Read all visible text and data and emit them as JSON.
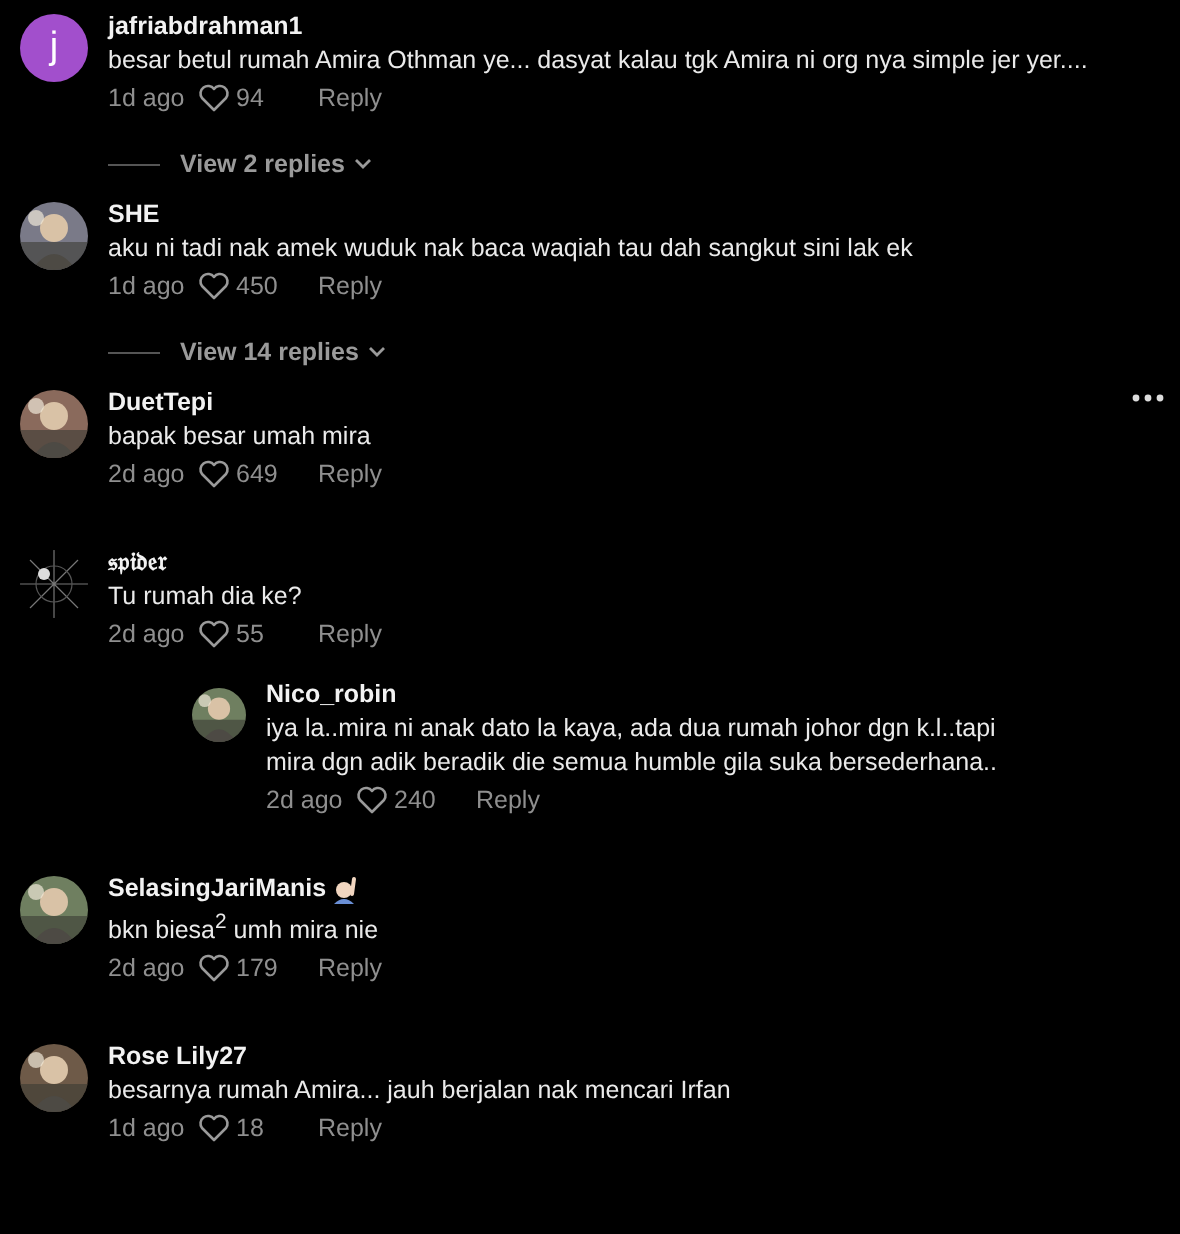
{
  "comments": [
    {
      "avatar": {
        "kind": "letter",
        "letter": "j",
        "color": "#a24fcc"
      },
      "username": "jafriabdrahman1",
      "text": "besar betul rumah Amira Othman ye... dasyat kalau tgk Amira ni org nya simple jer yer....",
      "time": "1d ago",
      "likes": "94",
      "reply": "Reply",
      "view_replies": "View 2 replies"
    },
    {
      "username": "SHE",
      "text": "aku ni tadi nak amek wuduk nak baca waqiah tau dah sangkut sini lak ek",
      "time": "1d ago",
      "likes": "450",
      "reply": "Reply",
      "view_replies": "View 14 replies"
    },
    {
      "username": "DuetTepi",
      "text": "bapak besar umah mira",
      "time": "2d ago",
      "likes": "649",
      "reply": "Reply",
      "more_menu": true
    },
    {
      "avatar": {
        "kind": "web"
      },
      "username": "𝔰𝔭𝔦𝔡𝔢𝔯",
      "text": "Tu rumah dia ke?",
      "time": "2d ago",
      "likes": "55",
      "reply": "Reply",
      "replies": [
        {
          "username": "Nico_robin",
          "text": "iya la..mira ni anak dato la kaya, ada dua rumah johor dgn k.l..tapi mira dgn adik beradik die semua humble gila suka bersederhana..",
          "time": "2d ago",
          "likes": "240",
          "reply": "Reply"
        }
      ]
    },
    {
      "username": "SelasingJariManis",
      "name_emoji": true,
      "text": "bkn biesa$^{2}$ umh mira nie",
      "time": "2d ago",
      "likes": "179",
      "reply": "Reply"
    },
    {
      "username": "Rose Lily27",
      "text": "besarnya rumah Amira... jauh berjalan nak mencari Irfan",
      "time": "1d ago",
      "likes": "18",
      "reply": "Reply"
    }
  ]
}
